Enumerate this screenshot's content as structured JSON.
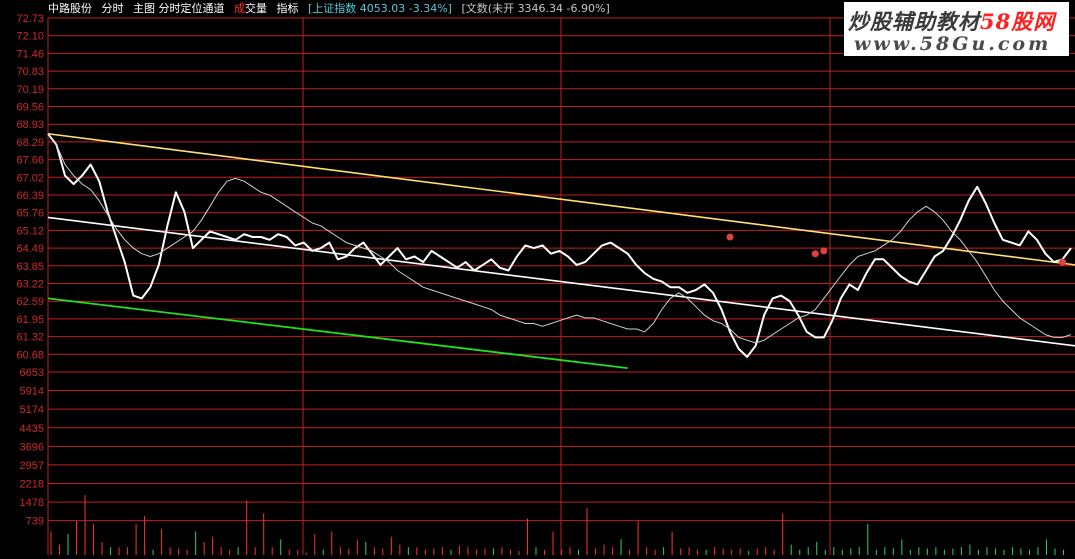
{
  "header": {
    "stock_name": "中路股份",
    "tab_timeshare": "分时",
    "indicator_name": "主图 分时定位通道",
    "volume_label_red": "成",
    "volume_label_rest": "交量",
    "indicator_tab": "指标",
    "index_info": "[上证指数 4053.03 -3.34%]",
    "wenhua_info": "[文数(未开 3346.34 -6.90%]"
  },
  "watermark": {
    "title_main": "炒股辅助教材",
    "title_accent": "58股网",
    "url": "www.58Gu.com"
  },
  "colors": {
    "grid": "#c02020",
    "price_line": "#ffffff",
    "avg_line": "#d0d0d0",
    "upper_channel": "#ffe070",
    "lower_channel": "#20e020",
    "mid_channel": "#ffffff",
    "vol_up": "#ff3030",
    "vol_down": "#30d060",
    "axis_text": "#d02828",
    "marker": "#e04040"
  },
  "chart_data": [
    {
      "type": "line",
      "title": "",
      "y_tick_labels": [
        "72.73",
        "72.10",
        "71.46",
        "70.83",
        "70.19",
        "69.56",
        "68.93",
        "68.29",
        "67.66",
        "67.02",
        "66.39",
        "65.76",
        "65.12",
        "64.49",
        "63.85",
        "63.22",
        "62.59",
        "61.95",
        "61.32",
        "60.68"
      ],
      "ylim": [
        60.36,
        73.05
      ],
      "x": [
        0,
        2,
        4,
        6,
        8,
        10,
        12,
        14,
        16,
        18,
        20,
        22,
        24,
        26,
        28,
        30,
        32,
        34,
        36,
        38,
        40,
        42,
        44,
        46,
        48,
        50,
        52,
        54,
        56,
        58,
        60,
        62,
        64,
        66,
        68,
        70,
        72,
        74,
        76,
        78,
        80,
        82,
        84,
        86,
        88,
        90,
        92,
        94,
        96,
        98,
        100,
        102,
        104,
        106,
        108,
        110,
        112,
        114,
        116,
        118,
        120,
        122,
        124,
        126,
        128,
        130,
        132,
        134,
        136,
        138,
        140,
        142,
        144,
        146,
        148,
        150,
        152,
        154,
        156,
        158,
        160,
        162,
        164,
        166,
        168,
        170,
        172,
        174,
        176,
        178,
        180,
        182,
        184,
        186,
        188,
        190,
        192,
        194,
        196,
        198,
        200,
        202,
        204,
        206,
        208,
        210,
        212,
        214,
        216,
        218,
        220,
        222,
        224,
        226,
        228,
        230,
        232,
        234,
        236,
        238,
        240
      ],
      "series": [
        {
          "values": [
            68.9,
            68.5,
            67.4,
            67.1,
            67.4,
            67.8,
            67.2,
            66.1,
            65.2,
            64.3,
            63.1,
            63.0,
            63.4,
            64.2,
            65.6,
            66.8,
            66.1,
            64.8,
            65.1,
            65.4,
            65.3,
            65.2,
            65.1,
            65.3,
            65.2,
            65.2,
            65.1,
            65.3,
            65.2,
            64.9,
            65.0,
            64.7,
            64.8,
            65.0,
            64.4,
            64.5,
            64.8,
            65.0,
            64.6,
            64.2,
            64.5,
            64.8,
            64.4,
            64.5,
            64.3,
            64.7,
            64.5,
            64.3,
            64.1,
            64.3,
            64.0,
            64.2,
            64.4,
            64.1,
            64.0,
            64.5,
            64.9,
            64.8,
            64.9,
            64.6,
            64.7,
            64.5,
            64.2,
            64.3,
            64.6,
            64.9,
            65.0,
            64.8,
            64.6,
            64.2,
            63.9,
            63.7,
            63.6,
            63.4,
            63.4,
            63.2,
            63.3,
            63.5,
            63.2,
            62.6,
            61.8,
            61.2,
            60.9,
            61.3,
            62.4,
            63.0,
            63.1,
            62.9,
            62.4,
            61.8,
            61.6,
            61.6,
            62.2,
            63.0,
            63.5,
            63.3,
            63.9,
            64.4,
            64.4,
            64.1,
            63.8,
            63.6,
            63.5,
            64.0,
            64.5,
            64.7,
            65.2,
            65.8,
            66.5,
            67.0,
            66.4,
            65.7,
            65.1,
            65.0,
            64.9,
            65.4,
            65.1,
            64.6,
            64.3,
            64.4,
            64.8
          ],
          "role": "price"
        },
        {
          "values": [
            68.9,
            68.5,
            67.8,
            67.4,
            67.1,
            66.9,
            66.5,
            66.0,
            65.5,
            65.1,
            64.8,
            64.6,
            64.5,
            64.6,
            64.8,
            65.0,
            65.2,
            65.4,
            65.8,
            66.3,
            66.8,
            67.2,
            67.3,
            67.2,
            67.0,
            66.8,
            66.7,
            66.5,
            66.3,
            66.1,
            65.9,
            65.7,
            65.6,
            65.4,
            65.2,
            65.0,
            64.9,
            64.8,
            64.7,
            64.5,
            64.3,
            64.0,
            63.8,
            63.6,
            63.4,
            63.3,
            63.2,
            63.1,
            63.0,
            62.9,
            62.8,
            62.7,
            62.6,
            62.4,
            62.3,
            62.2,
            62.1,
            62.1,
            62.0,
            62.1,
            62.2,
            62.3,
            62.4,
            62.3,
            62.3,
            62.2,
            62.1,
            62.0,
            61.9,
            61.9,
            61.8,
            62.1,
            62.6,
            63.0,
            63.2,
            63.0,
            62.7,
            62.4,
            62.2,
            62.1,
            61.9,
            61.6,
            61.5,
            61.4,
            61.5,
            61.7,
            61.9,
            62.1,
            62.3,
            62.4,
            62.6,
            63.0,
            63.4,
            63.8,
            64.2,
            64.5,
            64.6,
            64.7,
            64.9,
            65.1,
            65.4,
            65.8,
            66.1,
            66.3,
            66.1,
            65.8,
            65.4,
            65.1,
            64.7,
            64.3,
            63.8,
            63.3,
            62.9,
            62.6,
            62.3,
            62.1,
            61.9,
            61.7,
            61.6,
            61.6,
            61.7
          ],
          "role": "average"
        }
      ]
    },
    {
      "type": "bar",
      "title": "",
      "y_tick_labels": [
        "6653",
        "5914",
        "5174",
        "4435",
        "3696",
        "2957",
        "2218",
        "1478",
        "739"
      ],
      "ylim": [
        0,
        7020
      ],
      "values_up": [
        900,
        400,
        1300,
        2300,
        1200,
        500,
        300,
        300,
        1200,
        1500,
        1000,
        300,
        250,
        200,
        500,
        700,
        300,
        200,
        2100,
        300,
        1600,
        300,
        200,
        200,
        100,
        800,
        900,
        300,
        250,
        600,
        300,
        250,
        700,
        400,
        300,
        200,
        250,
        300,
        350,
        300,
        200,
        250,
        300,
        200,
        150,
        1400,
        200,
        900,
        200,
        300,
        1800,
        250,
        400,
        300,
        200,
        1300,
        300,
        200,
        900,
        250,
        300,
        200,
        300,
        250,
        200,
        250,
        250,
        300,
        200,
        1600
      ],
      "values_down": [
        800,
        300,
        200,
        900,
        300,
        600,
        200,
        500,
        300,
        200,
        250,
        300,
        200,
        600,
        300,
        200,
        150,
        400,
        200,
        300,
        500,
        200,
        300,
        200,
        250,
        300,
        1200,
        200,
        300,
        250,
        600,
        200,
        300,
        250,
        300,
        200,
        250,
        300,
        400,
        200,
        300,
        250,
        200,
        300,
        250,
        200,
        300,
        600,
        250,
        200
      ]
    }
  ]
}
